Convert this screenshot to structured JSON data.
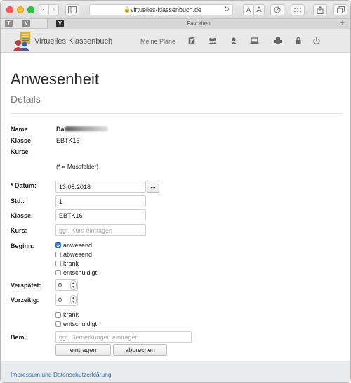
{
  "browser": {
    "url": "virtuelles-klassenbuch.de",
    "font_small": "A",
    "font_large": "A",
    "favorites_label": "Favoriten",
    "fav_items": [
      "T",
      "V"
    ],
    "active_tab_icon": "V"
  },
  "app": {
    "brand": "Virtuelles Klassenbuch",
    "nav_link": "Meine Pläne",
    "nav_icons": [
      "book-icon",
      "group-icon",
      "user-icon",
      "laptop-icon",
      "printer-icon",
      "lock-icon",
      "power-icon"
    ]
  },
  "page": {
    "title": "Anwesenheit",
    "subtitle": "Details"
  },
  "info": {
    "name_label": "Name",
    "name_value": "Ba",
    "klasse_label": "Klasse",
    "klasse_value": "EBTK16",
    "kurse_label": "Kurse",
    "required_note": "(* = Mussfelder)"
  },
  "form": {
    "datum_label": "* Datum:",
    "datum_value": "13.08.2018",
    "datum_button": "...",
    "std_label": "Std.:",
    "std_value": "1",
    "klasse_label": "Klasse:",
    "klasse_value": "EBTK16",
    "kurs_label": "Kurs:",
    "kurs_placeholder": "ggf. Kurs eintragen",
    "beginn_label": "Beginn:",
    "beginn_options": [
      {
        "label": "anwesend",
        "checked": true
      },
      {
        "label": "abwesend",
        "checked": false
      },
      {
        "label": "krank",
        "checked": false
      },
      {
        "label": "entschuldigt",
        "checked": false
      }
    ],
    "verspaetet_label": "Verspätet:",
    "verspaetet_value": "0",
    "vorzeitig_label": "Vorzeitig:",
    "vorzeitig_value": "0",
    "vorzeitig_options": [
      {
        "label": "krank",
        "checked": false
      },
      {
        "label": "entschuldigt",
        "checked": false
      }
    ],
    "bem_label": "Bem.:",
    "bem_placeholder": "ggf. Bemerkungen eintragen",
    "submit_label": "eintragen",
    "cancel_label": "abbrechen"
  },
  "footer": {
    "link": "Impressum und Datenschutzerklärung"
  },
  "colors": {
    "accent": "#2f7de1",
    "link": "#2f6ea5",
    "navbar": "#e9e9e9"
  }
}
